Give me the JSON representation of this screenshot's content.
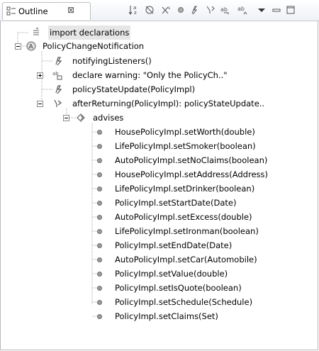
{
  "view": {
    "tab_label": "Outline",
    "tab_close": "⊠",
    "toolbar_icons": [
      "sort-az-icon",
      "hide-fields-icon",
      "hide-static-icon",
      "hide-nonpublic-icon",
      "advice-filter-icon",
      "filter-icon",
      "link-icon",
      "collapse-icon",
      "view-menu-icon",
      "minimize-icon",
      "maximize-icon"
    ]
  },
  "tree": {
    "imports": "import declarations",
    "aspect": "PolicyChangeNotification",
    "members": [
      "notifyingListeners()",
      "declare warning: \"Only the PolicyCh..\"",
      "policyStateUpdate(PolicyImpl)",
      "afterReturning(PolicyImpl): policyStateUpdate.."
    ],
    "advises_label": "advises",
    "advised": [
      "HousePolicyImpl.setWorth(double)",
      "LifePolicyImpl.setSmoker(boolean)",
      "AutoPolicyImpl.setNoClaims(boolean)",
      "HousePolicyImpl.setAddress(Address)",
      "LifePolicyImpl.setDrinker(boolean)",
      "PolicyImpl.setStartDate(Date)",
      "AutoPolicyImpl.setExcess(double)",
      "LifePolicyImpl.setIronman(boolean)",
      "PolicyImpl.setEndDate(Date)",
      "AutoPolicyImpl.setCar(Automobile)",
      "PolicyImpl.setValue(double)",
      "PolicyImpl.setIsQuote(boolean)",
      "PolicyImpl.setSchedule(Schedule)",
      "PolicyImpl.setClaims(Set)"
    ]
  }
}
